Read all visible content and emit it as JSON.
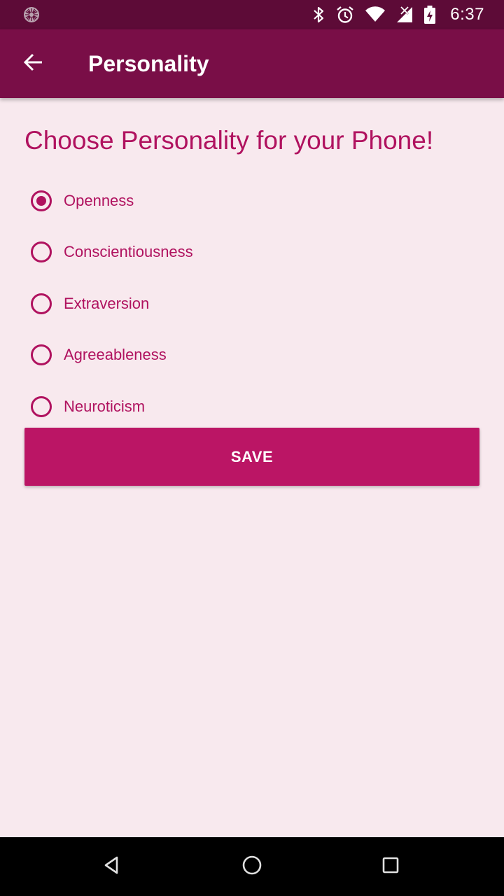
{
  "status_bar": {
    "time": "6:37",
    "icons": [
      "app-notification-icon",
      "bluetooth-icon",
      "alarm-icon",
      "wifi-icon",
      "no-signal-icon",
      "battery-charging-icon"
    ]
  },
  "app_bar": {
    "title": "Personality",
    "back_icon": "arrow-back-icon"
  },
  "main": {
    "heading": "Choose Personality for your Phone!",
    "options": [
      {
        "label": "Openness",
        "checked": true
      },
      {
        "label": "Conscientiousness",
        "checked": false
      },
      {
        "label": "Extraversion",
        "checked": false
      },
      {
        "label": "Agreeableness",
        "checked": false
      },
      {
        "label": "Neuroticism",
        "checked": false
      }
    ],
    "save_label": "SAVE"
  },
  "nav_bar": {
    "icons": [
      "back-triangle-icon",
      "home-circle-icon",
      "recents-square-icon"
    ]
  },
  "colors": {
    "status_bar": "#5d0b37",
    "app_bar": "#790e47",
    "accent": "#b0125f",
    "button": "#bb1565",
    "background": "#f8e9ee"
  }
}
